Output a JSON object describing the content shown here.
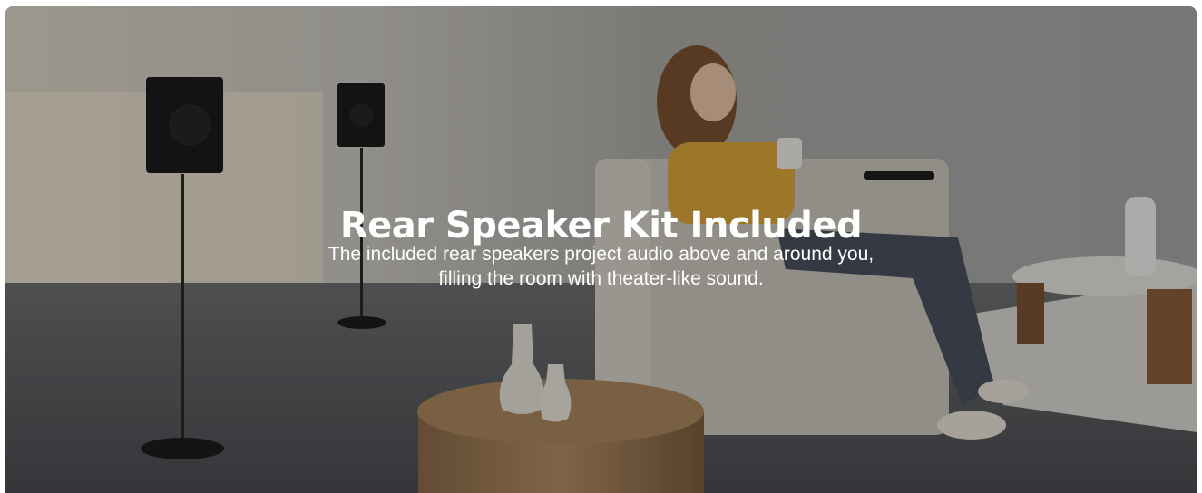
{
  "banner": {
    "title": "Rear Speaker Kit Included",
    "description_lines": [
      "The included rear speakers project audio above and around you,",
      "filling the room with theater-like sound."
    ]
  },
  "colors": {
    "text": "#ffffff",
    "overlay": "rgba(0,0,0,0.28)",
    "wall": "#9a9a95",
    "floor": "#55575a"
  }
}
